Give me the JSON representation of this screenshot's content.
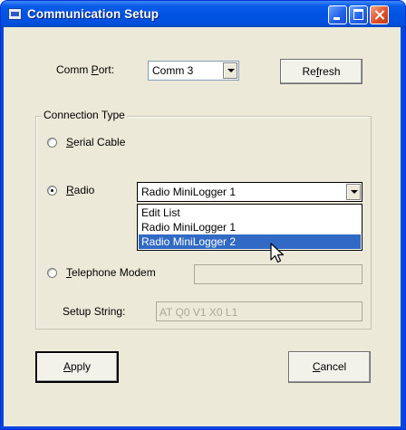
{
  "window": {
    "title": "Communication Setup",
    "buttons": {
      "minimize": "minimize-icon",
      "maximize": "maximize-icon",
      "close": "close-icon"
    }
  },
  "comm_port": {
    "label_prefix": "Comm ",
    "label_accel": "P",
    "label_suffix": "ort:",
    "value": "Comm 3"
  },
  "refresh": {
    "prefix": "Re",
    "accel": "f",
    "suffix": "resh"
  },
  "connection_type": {
    "title": "Connection Type",
    "serial": {
      "accel": "S",
      "rest": "erial Cable",
      "selected": false
    },
    "radio": {
      "accel": "R",
      "rest": "adio",
      "selected": true
    },
    "telephone": {
      "accel": "T",
      "rest": "elephone Modem",
      "selected": false
    }
  },
  "radio_combo": {
    "value": "Radio MiniLogger 1",
    "options": [
      "Edit List",
      "Radio MiniLogger 1",
      "Radio MiniLogger 2"
    ],
    "highlighted": "Radio MiniLogger 2"
  },
  "setup_string": {
    "label": "Setup String:",
    "value": "AT Q0 V1 X0 L1"
  },
  "apply": {
    "accel": "A",
    "rest": "pply"
  },
  "cancel": {
    "accel": "C",
    "rest": "ancel"
  },
  "colors": {
    "titlebar": "#0054e3",
    "selection": "#316ac5",
    "dialog_bg": "#ece9d8"
  }
}
